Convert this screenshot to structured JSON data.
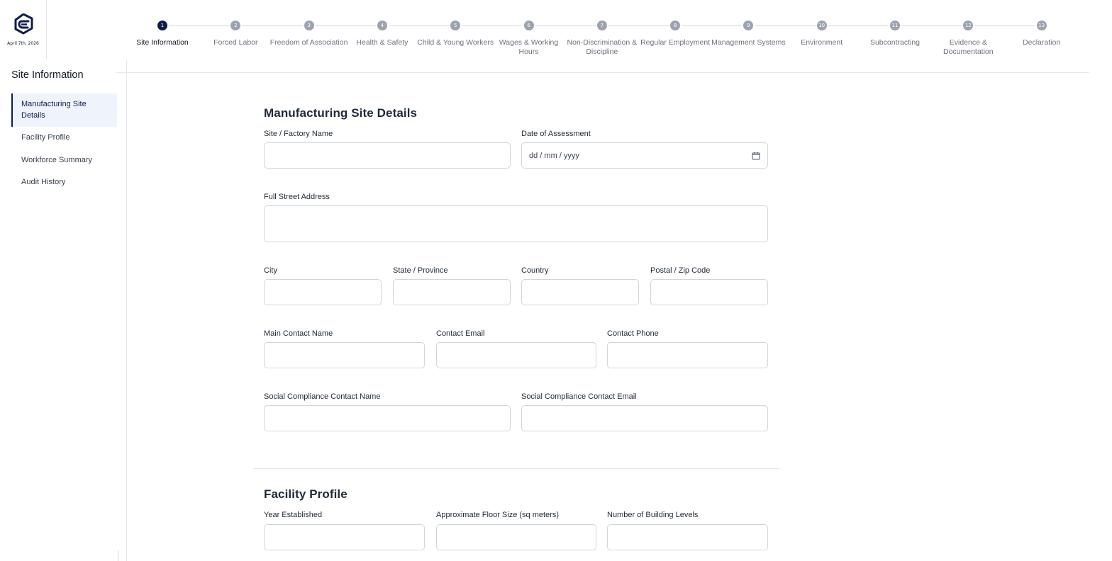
{
  "logo": {
    "date": "April 7th, 2026",
    "icon": "brand-logo-icon"
  },
  "stepper": {
    "active_index": 0,
    "steps": [
      {
        "number": "1",
        "label": "Site Information"
      },
      {
        "number": "2",
        "label": "Forced Labor"
      },
      {
        "number": "3",
        "label": "Freedom of Association"
      },
      {
        "number": "4",
        "label": "Health & Safety"
      },
      {
        "number": "5",
        "label": "Child & Young Workers"
      },
      {
        "number": "6",
        "label": "Wages & Working Hours"
      },
      {
        "number": "7",
        "label": "Non-Discrimination & Discipline"
      },
      {
        "number": "8",
        "label": "Regular Employment"
      },
      {
        "number": "9",
        "label": "Management Systems"
      },
      {
        "number": "10",
        "label": "Environment"
      },
      {
        "number": "11",
        "label": "Subcontracting"
      },
      {
        "number": "12",
        "label": "Evidence & Documentation"
      },
      {
        "number": "13",
        "label": "Declaration"
      }
    ]
  },
  "sidebar": {
    "title": "Site Information",
    "items": [
      {
        "label": "Manufacturing Site Details",
        "active": true
      },
      {
        "label": "Facility Profile",
        "active": false
      },
      {
        "label": "Workforce Summary",
        "active": false
      },
      {
        "label": "Audit History",
        "active": false
      }
    ]
  },
  "manufacturing": {
    "title": "Manufacturing Site Details",
    "site_name_label": "Site / Factory Name",
    "site_name_value": "",
    "date_label": "Date of Assessment",
    "date_placeholder": "dd / mm / yyyy",
    "address_label": "Full Street Address",
    "address_value": "",
    "city_label": "City",
    "state_label": "State / Province",
    "country_label": "Country",
    "postal_label": "Postal / Zip Code",
    "contact_name_label": "Main Contact Name",
    "contact_email_label": "Contact Email",
    "contact_phone_label": "Contact Phone",
    "social_name_label": "Social Compliance Contact Name",
    "social_email_label": "Social Compliance Contact Email"
  },
  "facility": {
    "title": "Facility Profile",
    "year_label": "Year Established",
    "floor_label": "Approximate Floor Size (sq meters)",
    "levels_label": "Number of Building Levels"
  },
  "colors": {
    "accent": "#0f1d4a",
    "active_nav_bg": "#eef3fc",
    "inactive_step": "#9ca3af",
    "border": "#d1d5db"
  }
}
